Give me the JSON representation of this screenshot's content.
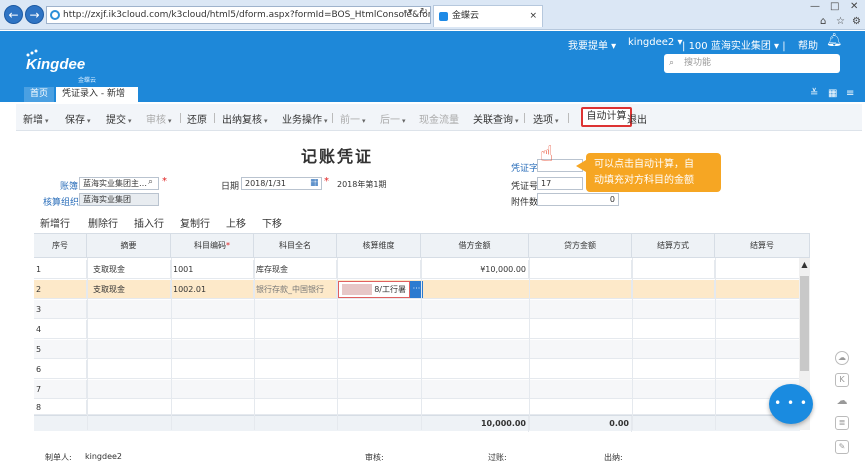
{
  "browser": {
    "url": "http://zxjf.ik3cloud.com/k3cloud/html5/dform.aspx?formId=BOS_HtmlConsole&formType=",
    "tab_title": "金蝶云",
    "tab_close": "×"
  },
  "header": {
    "logo_text": "Kingdee",
    "logo_sub": "金蝶云",
    "links": {
      "issue": "我要提单",
      "user": "kingdee2",
      "org": "100 蓝海实业集团",
      "help": "帮助"
    },
    "search_placeholder": "搜功能"
  },
  "page_tabs": {
    "home": "首页",
    "current": "凭证录入 - 新增",
    "close": "×"
  },
  "toolbar": {
    "new": "新增",
    "save": "保存",
    "submit": "提交",
    "audit": "审核",
    "restore": "还原",
    "cashier_review": "出纳复核",
    "business_ops": "业务操作",
    "prev": "前一",
    "next": "后一",
    "cash_flow": "现金流量",
    "link_query": "关联查询",
    "options": "选项",
    "auto_calc": "自动计算",
    "exit": "退出"
  },
  "title": "记账凭证",
  "form": {
    "book_label": "账簿",
    "book_value": "蓝海实业集团主…",
    "org_label": "核算组织",
    "org_value": "蓝海实业集团",
    "date_label": "日期",
    "date_value": "2018/1/31",
    "period": "2018年第1期",
    "voucher_word_label": "凭证字",
    "voucher_no_label": "凭证号",
    "voucher_no_value": "17",
    "attach_label": "附件数",
    "attach_value": "0"
  },
  "callout": {
    "line1": "可以点击自动计算，自",
    "line2": "动填充对方科目的金额"
  },
  "grid_toolbar": {
    "add_row": "新增行",
    "del_row": "删除行",
    "insert_row": "插入行",
    "copy_row": "复制行",
    "move_up": "上移",
    "move_down": "下移"
  },
  "grid": {
    "headers": [
      "序号",
      "摘要",
      "科目编码",
      "科目全名",
      "核算维度",
      "借方金额",
      "贷方金额",
      "结算方式",
      "结算号"
    ],
    "rows": [
      {
        "no": "1",
        "summary": "支取现金",
        "code": "1001",
        "name": "库存现金",
        "dim": "",
        "debit": "¥10,000.00",
        "credit": ""
      },
      {
        "no": "2",
        "summary": "支取现金",
        "code": "1002.01",
        "name": "银行存款_中国银行",
        "dim": "8/工行暑",
        "debit": "",
        "credit": ""
      },
      {
        "no": "3"
      },
      {
        "no": "4"
      },
      {
        "no": "5"
      },
      {
        "no": "6"
      },
      {
        "no": "7"
      },
      {
        "no": "8"
      }
    ],
    "total_debit": "10,000.00",
    "total_credit": "0.00"
  },
  "footer": {
    "maker_label": "制单人:",
    "maker_value": "kingdee2",
    "auditor_label": "审核:",
    "poster_label": "过账:",
    "cashier_label": "出纳:"
  },
  "colors": {
    "brand": "#1e88d9",
    "callout": "#f6a623",
    "highlight_row": "#fde9c9",
    "alert": "#d33333"
  }
}
